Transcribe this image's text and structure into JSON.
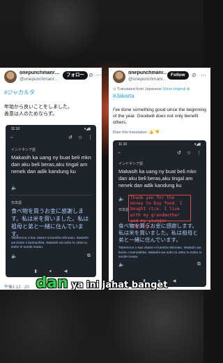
{
  "left": {
    "name": "onepunchmanr…",
    "handle": "@onepunchmanr…",
    "follow_label": "フォロー",
    "hashtag": "#ジャカルタ",
    "text_line1": "年始から良いことをしました。",
    "text_line2": "善意は人のためならず。",
    "timestamp": "午後1:12 · 20",
    "phone": {
      "time": "11:10",
      "source_lang": "インドネシア語",
      "source_text": "Makasih ka uang ny buat beli mkn dan aku beli beras,aku tingal am nenek dan adik kandung ku",
      "target_lang": "日本語",
      "translation": "食べ物を買うお金に感謝します。私は米を買いました。私は祖母と弟と一緒に住んでいます。",
      "romaji": "Tabemono o kau okane ni kansha shimasu. Watashi wa kome o kaimashita. Watashi wa sobo to otōto to issho ni sunde imasu."
    }
  },
  "right": {
    "name": "onepunchmanr…",
    "handle": "@onepunchmanr…",
    "follow_label": "Follow",
    "translated_note": "Translated from Japanese",
    "show_original": "Show original",
    "hashtag": "#Jakarta",
    "text": "I've done something good since the beginning of the year. Goodwill does not only benefit others.",
    "rate_label": "Rate this translation:",
    "phone": {
      "time": "11:10",
      "source_lang": "インドネシア語",
      "source_text": "Makasih ka uang ny buat beli mkn dan aku beli beras,aku tingal am nenek dan adik kandung ku",
      "annotation": "Thank you for the money to buy food. I bought rice. I live with my grandmother and my younger sibling.",
      "target_lang": "日本語",
      "translation": "食べ物を買うお金に感謝します。私は米を買いました。私は祖母と弟と一緒に住んでいます。",
      "romaji": "Tabemono o kau okane ni kansha shimasu. Watashi wa kome o kaimashita. Watashi wa sobo to otōto to issho ni sunde imasu."
    }
  },
  "caption": {
    "highlight": "dan",
    "rest": " ya ini jahat banget"
  },
  "colors": {
    "accent": "#1d9bf0",
    "caption_green": "#2fd14a",
    "annotation_red": "#ff4d5e"
  }
}
